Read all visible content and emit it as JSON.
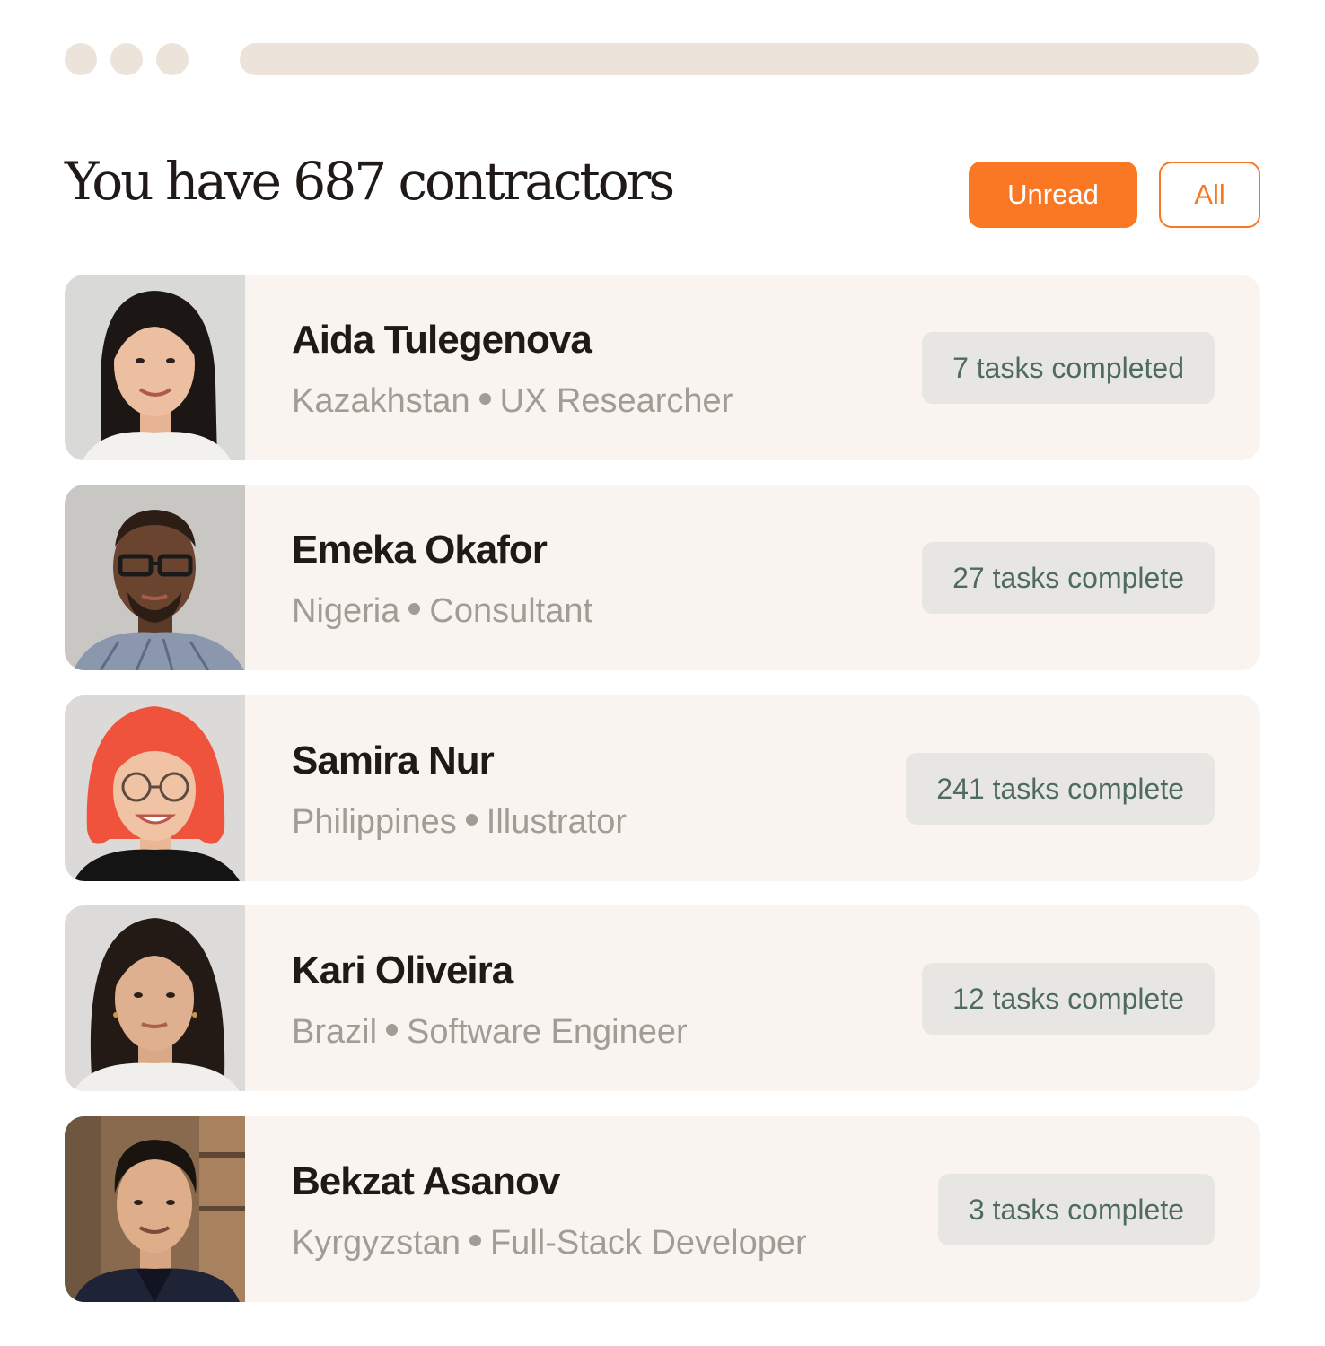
{
  "window": {
    "controls": [
      "close-dot",
      "minimize-dot",
      "maximize-dot"
    ]
  },
  "header": {
    "title": "You have 687 contractors",
    "filters": {
      "unread_label": "Unread",
      "all_label": "All"
    }
  },
  "contractors": [
    {
      "name": "Aida Tulegenova",
      "country": "Kazakhstan",
      "role": "UX Researcher",
      "tasks": "7 tasks completed"
    },
    {
      "name": "Emeka Okafor",
      "country": "Nigeria",
      "role": "Consultant",
      "tasks": "27 tasks complete"
    },
    {
      "name": "Samira Nur",
      "country": "Philippines",
      "role": "Illustrator",
      "tasks": "241 tasks complete"
    },
    {
      "name": "Kari Oliveira",
      "country": "Brazil",
      "role": "Software Engineer",
      "tasks": "12 tasks complete"
    },
    {
      "name": "Bekzat Asanov",
      "country": "Kyrgyzstan",
      "role": "Full-Stack Developer",
      "tasks": "3 tasks complete"
    }
  ],
  "colors": {
    "accent": "#fa7724",
    "card_bg": "#f9f4ef",
    "badge_bg": "#e8e6e2",
    "badge_text": "#4e6b60",
    "meta_text": "#a39c95",
    "chrome": "#ece4da"
  }
}
